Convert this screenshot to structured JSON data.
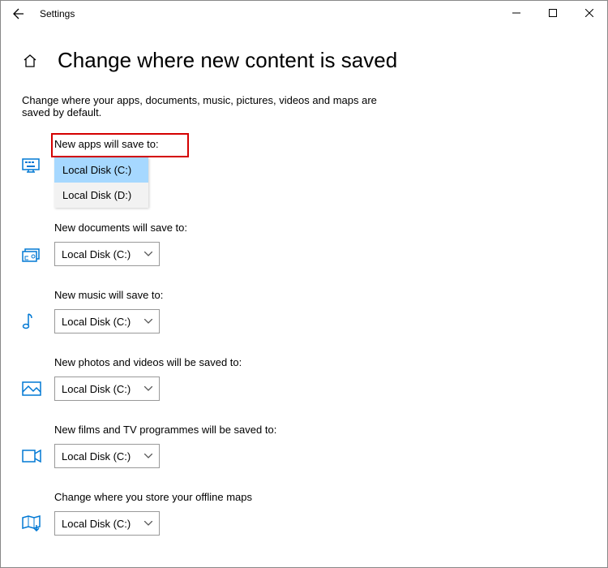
{
  "window": {
    "title": "Settings"
  },
  "page": {
    "heading": "Change where new content is saved",
    "description": "Change where your apps, documents, music, pictures, videos and maps are saved by default."
  },
  "dropdown_options": [
    "Local Disk (C:)",
    "Local Disk (D:)"
  ],
  "sections": {
    "apps": {
      "label": "New apps will save to:",
      "value": "Local Disk (C:)"
    },
    "docs": {
      "label": "New documents will save to:",
      "value": "Local Disk (C:)"
    },
    "music": {
      "label": "New music will save to:",
      "value": "Local Disk (C:)"
    },
    "photos": {
      "label": "New photos and videos will be saved to:",
      "value": "Local Disk (C:)"
    },
    "films": {
      "label": "New films and TV programmes will be saved to:",
      "value": "Local Disk (C:)"
    },
    "maps": {
      "label": "Change where you store your offline maps",
      "value": "Local Disk (C:)"
    }
  }
}
